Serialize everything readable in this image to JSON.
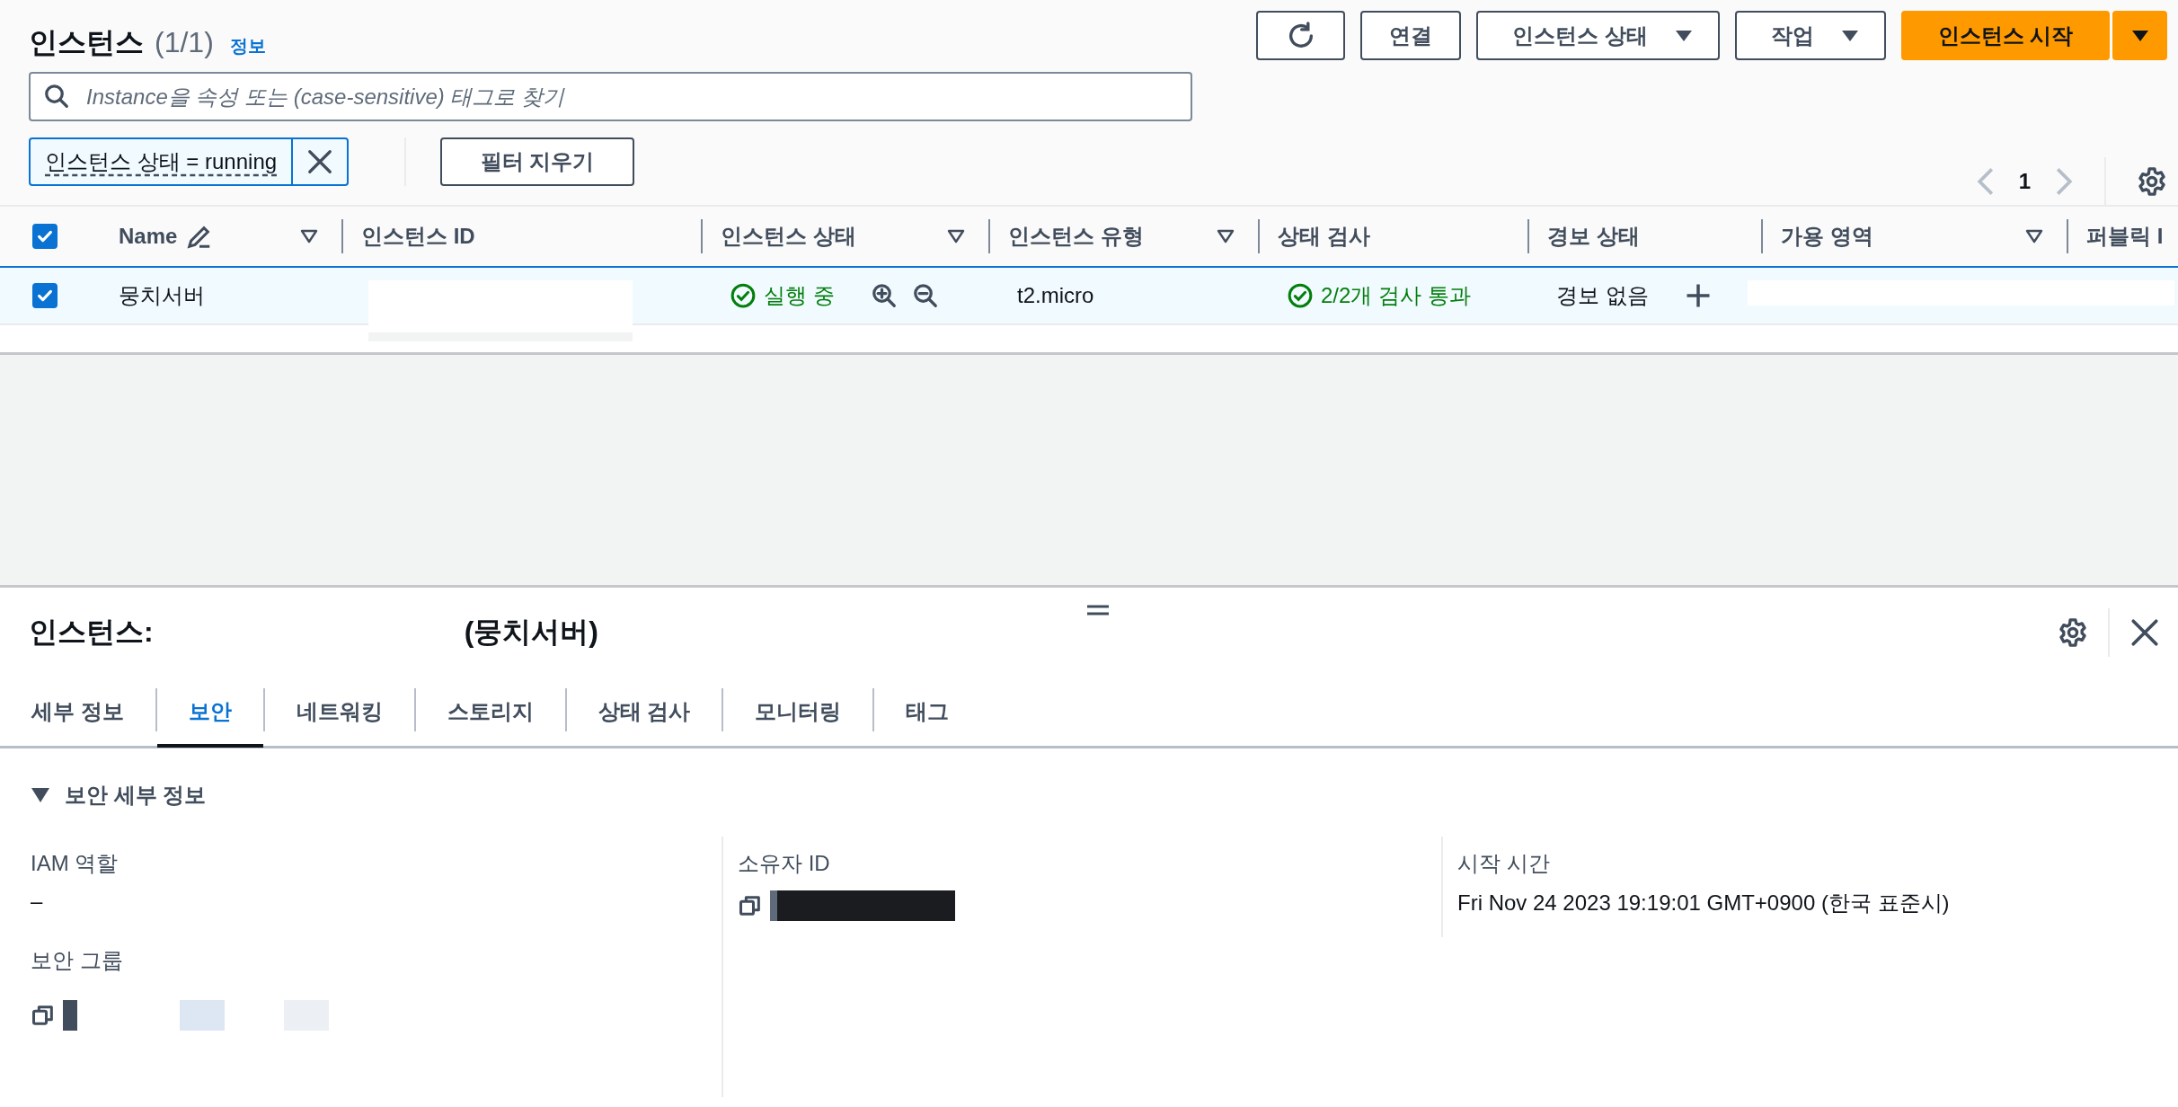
{
  "header": {
    "title": "인스턴스",
    "count": "(1/1)",
    "info_link": "정보"
  },
  "toolbar": {
    "buttons": [
      {
        "kind": "refresh"
      },
      {
        "kind": "plain",
        "label": "연결"
      },
      {
        "kind": "dropdown",
        "label": "인스턴스 상태"
      },
      {
        "kind": "dropdown",
        "label": "작업"
      },
      {
        "kind": "primary-split",
        "label": "인스턴스 시작"
      }
    ]
  },
  "search": {
    "placeholder": "Instance을 속성 또는 (case-sensitive) 태그로 찾기"
  },
  "filter_token": {
    "label": "인스턴스 상태 = running"
  },
  "clear_filters": "필터 지우기",
  "pagination": {
    "page": "1"
  },
  "table": {
    "all_selected": true,
    "columns": [
      {
        "label": "Name",
        "editable": true,
        "sortable": true
      },
      {
        "label": "인스턴스 ID",
        "editable": false,
        "sortable": false
      },
      {
        "label": "인스턴스 상태",
        "editable": false,
        "sortable": true
      },
      {
        "label": "인스턴스 유형",
        "editable": false,
        "sortable": true
      },
      {
        "label": "상태 검사",
        "editable": false,
        "sortable": false
      },
      {
        "label": "경보 상태",
        "editable": false,
        "sortable": false
      },
      {
        "label": "가용 영역",
        "editable": false,
        "sortable": true
      },
      {
        "label": "퍼블릭 I"
      }
    ],
    "rows": [
      {
        "selected": true,
        "name": "뭉치서버",
        "state": "실행 중",
        "type": "t2.micro",
        "status_check": "2/2개 검사 통과",
        "alarm_status": "경보 없음"
      }
    ]
  },
  "detail": {
    "title": "인스턴스:",
    "name": "(뭉치서버)",
    "tabs": [
      {
        "label": "세부 정보",
        "selected": false
      },
      {
        "label": "보안",
        "selected": true
      },
      {
        "label": "네트워킹",
        "selected": false
      },
      {
        "label": "스토리지",
        "selected": false
      },
      {
        "label": "상태 검사",
        "selected": false
      },
      {
        "label": "모니터링",
        "selected": false
      },
      {
        "label": "태그",
        "selected": false
      }
    ],
    "section": {
      "title": "보안 세부 정보",
      "expanded": true,
      "columns": [
        [
          {
            "label": "IAM 역할",
            "kind": "text",
            "value": "–"
          },
          {
            "label": "보안 그룹",
            "kind": "redacted-group"
          }
        ],
        [
          {
            "label": "소유자 ID",
            "kind": "redacted-id"
          }
        ],
        [
          {
            "label": "시작 시간",
            "kind": "text",
            "value": "Fri Nov 24 2023 19:19:01 GMT+0900 (한국 표준시)"
          }
        ]
      ]
    }
  }
}
